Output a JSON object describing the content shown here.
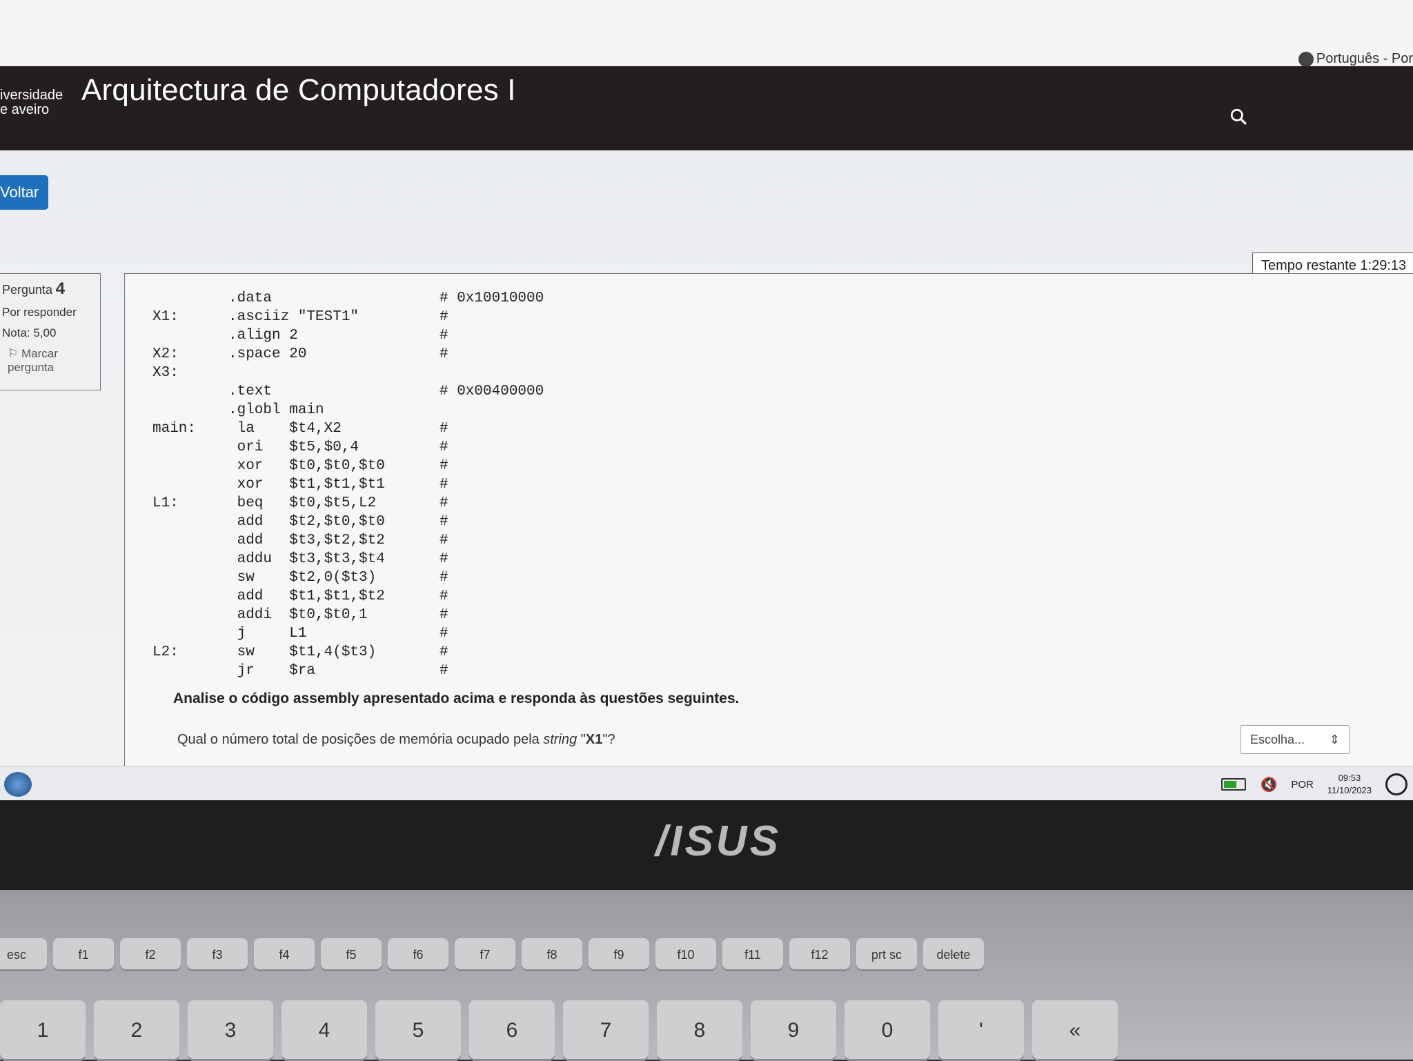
{
  "header": {
    "language": "Português - Por",
    "university_line1": "iversidade",
    "university_line2": "e aveiro",
    "course_title": "Arquitectura de Computadores I"
  },
  "nav": {
    "back_label": "Voltar"
  },
  "timer": "Tempo restante 1:29:13",
  "question_info": {
    "label": "Pergunta",
    "number": "4",
    "status": "Por responder",
    "grade": "Nota: 5,00",
    "flag_line1": "Marcar",
    "flag_line2": "pergunta"
  },
  "code": [
    {
      "label": "",
      "instr": ".data",
      "comment": "# 0x10010000"
    },
    {
      "label": "X1:",
      "instr": ".asciiz \"TEST1\"",
      "comment": "#"
    },
    {
      "label": "",
      "instr": ".align 2",
      "comment": "#"
    },
    {
      "label": "X2:",
      "instr": ".space 20",
      "comment": "#"
    },
    {
      "label": "X3:",
      "instr": "",
      "comment": ""
    },
    {
      "label": "",
      "instr": ".text",
      "comment": "# 0x00400000"
    },
    {
      "label": "",
      "instr": ".globl main",
      "comment": ""
    },
    {
      "label": "main:",
      "instr": " la    $t4,X2",
      "comment": "#"
    },
    {
      "label": "",
      "instr": " ori   $t5,$0,4",
      "comment": "#"
    },
    {
      "label": "",
      "instr": " xor   $t0,$t0,$t0",
      "comment": "#"
    },
    {
      "label": "",
      "instr": " xor   $t1,$t1,$t1",
      "comment": "#"
    },
    {
      "label": "L1:",
      "instr": " beq   $t0,$t5,L2",
      "comment": "#"
    },
    {
      "label": "",
      "instr": " add   $t2,$t0,$t0",
      "comment": "#"
    },
    {
      "label": "",
      "instr": " add   $t3,$t2,$t2",
      "comment": "#"
    },
    {
      "label": "",
      "instr": " addu  $t3,$t3,$t4",
      "comment": "#"
    },
    {
      "label": "",
      "instr": " sw    $t2,0($t3)",
      "comment": "#"
    },
    {
      "label": "",
      "instr": " add   $t1,$t1,$t2",
      "comment": "#"
    },
    {
      "label": "",
      "instr": " addi  $t0,$t0,1",
      "comment": "#"
    },
    {
      "label": "",
      "instr": " j     L1",
      "comment": "#"
    },
    {
      "label": "L2:",
      "instr": " sw    $t1,4($t3)",
      "comment": "#"
    },
    {
      "label": "",
      "instr": " jr    $ra",
      "comment": "#"
    }
  ],
  "prompt": "Analise o código assembly apresentado acima e responda às questões seguintes.",
  "question": {
    "before": "Qual o número total de posições de memória ocupado pela ",
    "italic": "string",
    "quote_open": " \"",
    "bold": "X1",
    "after": "\"?"
  },
  "answer_select": {
    "value": "Escolha...",
    "arrow": "⇕"
  },
  "taskbar": {
    "lang": "POR",
    "time": "09:53",
    "date": "11/10/2023"
  },
  "laptop": {
    "brand": "/ISUS",
    "fn_keys": [
      "esc",
      "f1",
      "f2",
      "f3",
      "f4",
      "f5",
      "f6",
      "f7",
      "f8",
      "f9",
      "f10",
      "f11",
      "f12",
      "prt sc",
      "delete"
    ],
    "num_keys": [
      "1",
      "2",
      "3",
      "4",
      "5",
      "6",
      "7",
      "8",
      "9",
      "0",
      "'",
      "«"
    ]
  },
  "colors": {
    "header_bg": "#231f20",
    "button_bg": "#1f6fbf"
  }
}
